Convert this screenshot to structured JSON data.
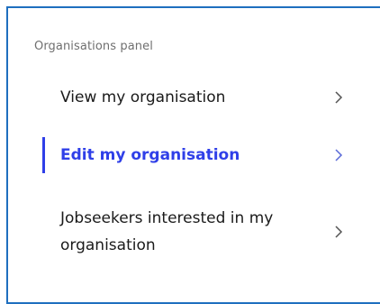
{
  "panel": {
    "title": "Organisations panel",
    "items": [
      {
        "label": "View my organisation",
        "active": false
      },
      {
        "label": "Edit my organisation",
        "active": true
      },
      {
        "label": "Jobseekers interested in my organisation",
        "active": false
      }
    ]
  },
  "colors": {
    "active": "#2f3fe8",
    "border": "#1f6fbf",
    "text": "#1a1a1a",
    "muted": "#6f6f6f"
  },
  "icons": {
    "chevron": "chevron-right-icon"
  }
}
